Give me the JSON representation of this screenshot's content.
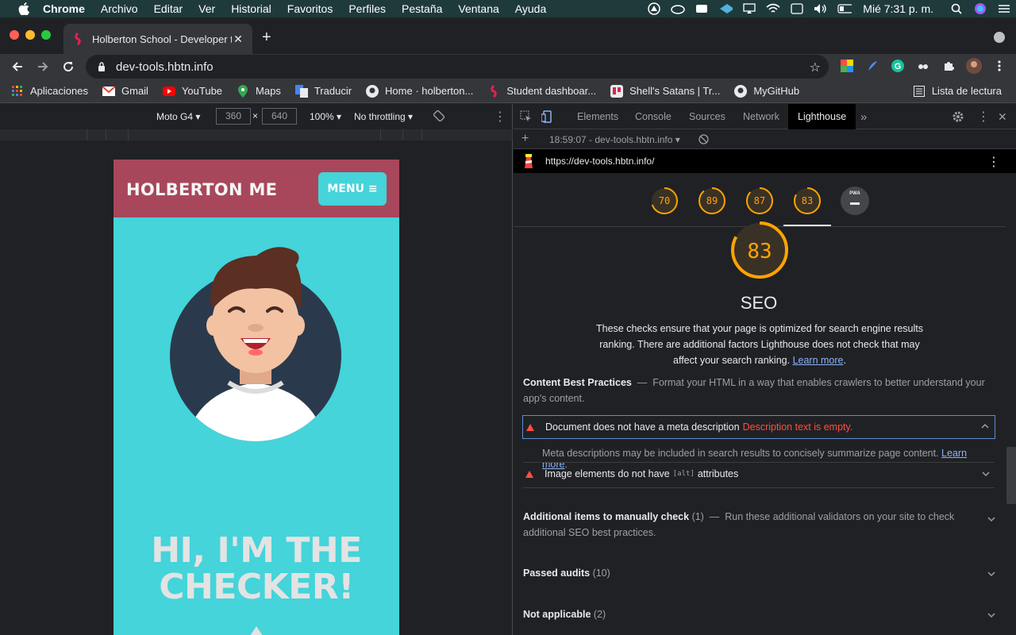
{
  "menubar": {
    "app_name": "Chrome",
    "items": [
      "Archivo",
      "Editar",
      "Ver",
      "Historial",
      "Favoritos",
      "Perfiles",
      "Pestaña",
      "Ventana",
      "Ayuda"
    ],
    "clock": "Mié 7:31 p. m."
  },
  "browser": {
    "tab_title": "Holberton School - Developer t",
    "url": "dev-tools.hbtn.info",
    "bookmarks": [
      {
        "label": "Aplicaciones",
        "icon": "apps-grid-icon"
      },
      {
        "label": "Gmail",
        "icon": "gmail-icon"
      },
      {
        "label": "YouTube",
        "icon": "youtube-icon"
      },
      {
        "label": "Maps",
        "icon": "maps-icon"
      },
      {
        "label": "Traducir",
        "icon": "translate-icon"
      },
      {
        "label": "Home · holberton...",
        "icon": "github-icon"
      },
      {
        "label": "Student dashboar...",
        "icon": "holberton-icon"
      },
      {
        "label": "Shell's Satans | Tr...",
        "icon": "trello-icon"
      },
      {
        "label": "MyGitHub",
        "icon": "github-icon"
      }
    ],
    "reading_list": "Lista de lectura"
  },
  "device_toolbar": {
    "device": "Moto G4",
    "width": "360",
    "height": "640",
    "zoom": "100%",
    "throttling": "No throttling"
  },
  "emulated_page": {
    "logo": "HOLBERTON ME",
    "menu_button": "MENU ≡",
    "hero_line1": "HI, I'M THE",
    "hero_line2": "CHECKER!"
  },
  "devtools": {
    "tabs": [
      "Elements",
      "Console",
      "Sources",
      "Network",
      "Lighthouse"
    ],
    "active_tab": "Lighthouse",
    "report_time": "18:59:07 - dev-tools.hbtn.info",
    "report_url": "https://dev-tools.hbtn.info/",
    "scores": [
      70,
      89,
      87,
      83
    ],
    "pwa_label": "PWA",
    "current_score": "83",
    "category_title": "SEO",
    "category_description": "These checks ensure that your page is optimized for search engine results ranking. There are additional factors Lighthouse does not check that may affect your search ranking.",
    "learn_more": "Learn more",
    "content_group_title": "Content Best Practices",
    "content_group_desc": "Format your HTML in a way that enables crawlers to better understand your app's content.",
    "audit1_title": "Document does not have a meta description",
    "audit1_error": "Description text is empty.",
    "audit1_detail": "Meta descriptions may be included in search results to concisely summarize page content.",
    "audit2_pre": "Image elements do not have",
    "audit2_code": "[alt]",
    "audit2_post": "attributes",
    "manual_title": "Additional items to manually check",
    "manual_count": "(1)",
    "manual_desc": "Run these additional validators on your site to check additional SEO best practices.",
    "passed_title": "Passed audits",
    "passed_count": "(10)",
    "na_title": "Not applicable",
    "na_count": "(2)"
  },
  "colors": {
    "score_average": "#ffa400",
    "fail_red": "#ff4e42",
    "link_blue": "#8ab4f8",
    "page_teal": "#44d4da",
    "page_header": "#a8475b"
  }
}
